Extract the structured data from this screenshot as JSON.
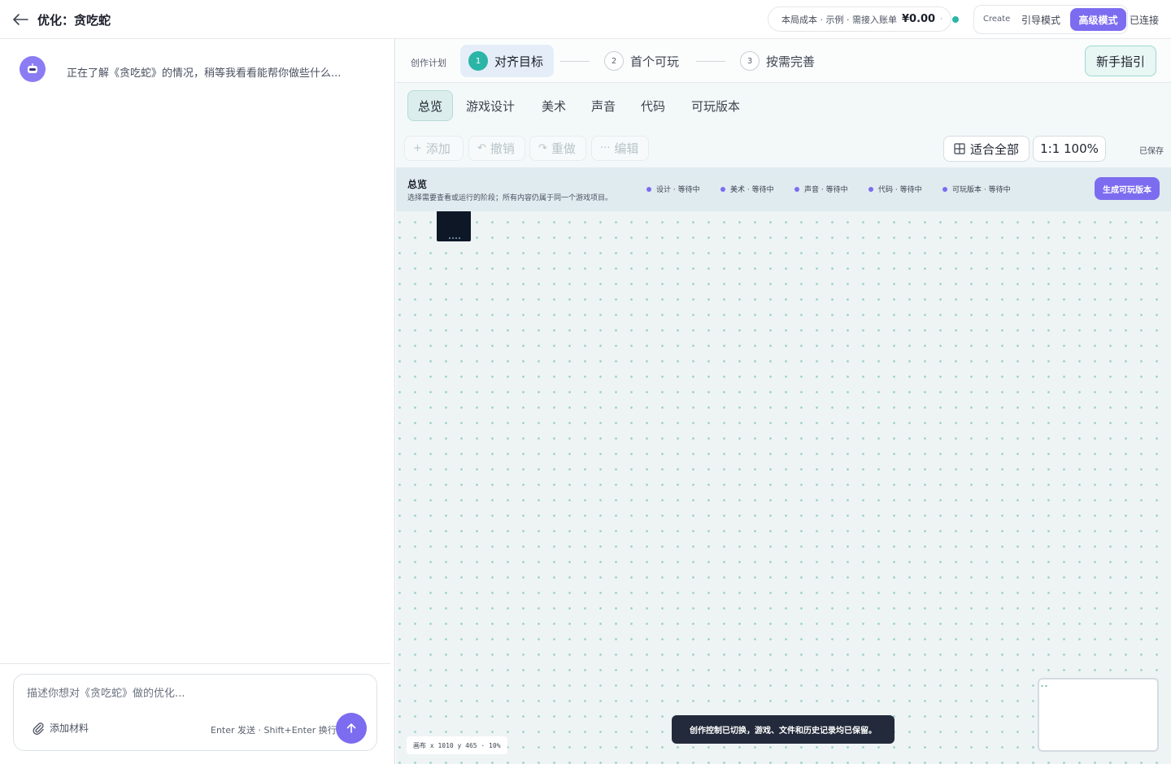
{
  "header": {
    "back_icon": "arrow-left-icon",
    "title": "优化：贪吃蛇",
    "cost": {
      "label": "本局成本 · 示例 · 需接入账单",
      "amount": "¥0.00",
      "caret": "·"
    },
    "status_color": "#2bb5a6",
    "modes": {
      "create": "Create",
      "guide": "引导模式",
      "advanced": "高级模式"
    },
    "connection": "已连接"
  },
  "chat": {
    "assistant_icon": "robot-icon",
    "message": "正在了解《贪吃蛇》的情况，稍等我看看能帮你做些什么...",
    "composer": {
      "placeholder": "描述你想对《贪吃蛇》做的优化...",
      "attach_label": "添加材料",
      "attach_icon": "paperclip-icon",
      "hint": "Enter 发送 · Shift+Enter 换行",
      "send_icon": "arrow-up-icon"
    }
  },
  "plan": {
    "label": "创作计划",
    "steps": [
      {
        "num": "1",
        "label": "对齐目标",
        "active": true
      },
      {
        "num": "2",
        "label": "首个可玩",
        "active": false
      },
      {
        "num": "3",
        "label": "按需完善",
        "active": false
      }
    ],
    "guide_button": "新手指引"
  },
  "tabs": [
    "总览",
    "游戏设计",
    "美术",
    "声音",
    "代码",
    "可玩版本"
  ],
  "toolbar": {
    "add": "添加",
    "undo": "撤销",
    "redo": "重做",
    "edit": "编辑",
    "fit": "适合全部",
    "zoom": "1:1 100%",
    "saved": "已保存"
  },
  "overview": {
    "title": "总览",
    "desc": "选择需要查看或运行的阶段；所有内容仍属于同一个游戏项目。",
    "stages": [
      "设计 · 等待中",
      "美术 · 等待中",
      "声音 · 等待中",
      "代码 · 等待中",
      "可玩版本 · 等待中"
    ],
    "generate_button": "生成可玩版本"
  },
  "canvas": {
    "readout": "画布 x 1010 y 465 · 10%",
    "toast": "创作控制已切换，游戏、文件和历史记录均已保留。"
  },
  "colors": {
    "accent": "#7c6cf0",
    "teal": "#2bb5a6",
    "dark": "#232a3b"
  }
}
